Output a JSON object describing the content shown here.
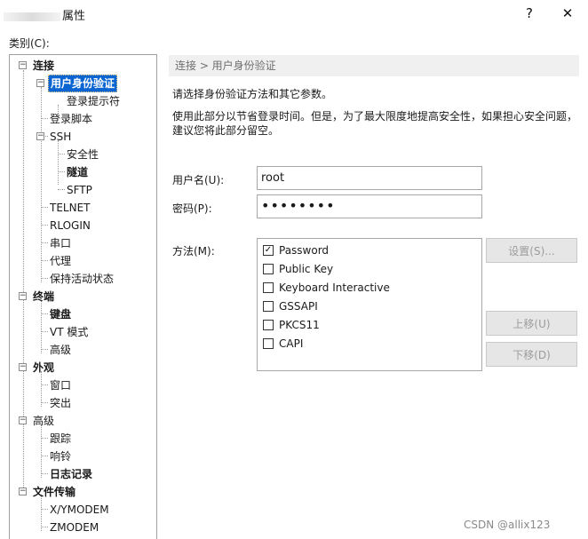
{
  "window": {
    "title": "属性",
    "help_label": "?",
    "close_label": "✕"
  },
  "category_label": "类别(C):",
  "tree": [
    {
      "label": "连接",
      "bold": true,
      "expander": "−"
    },
    {
      "label": "用户身份验证",
      "bold": true,
      "selected": true,
      "expander": "−"
    },
    {
      "label": "登录提示符"
    },
    {
      "label": "登录脚本"
    },
    {
      "label": "SSH",
      "expander": "−"
    },
    {
      "label": "安全性"
    },
    {
      "label": "隧道",
      "bold": true
    },
    {
      "label": "SFTP"
    },
    {
      "label": "TELNET"
    },
    {
      "label": "RLOGIN"
    },
    {
      "label": "串口"
    },
    {
      "label": "代理"
    },
    {
      "label": "保持活动状态"
    },
    {
      "label": "终端",
      "bold": true,
      "expander": "−"
    },
    {
      "label": "键盘",
      "bold": true
    },
    {
      "label": "VT 模式"
    },
    {
      "label": "高级"
    },
    {
      "label": "外观",
      "bold": true,
      "expander": "−"
    },
    {
      "label": "窗口"
    },
    {
      "label": "突出"
    },
    {
      "label": "高级",
      "expander": "−"
    },
    {
      "label": "跟踪"
    },
    {
      "label": "响铃"
    },
    {
      "label": "日志记录",
      "bold": true
    },
    {
      "label": "文件传输",
      "bold": true,
      "expander": "−"
    },
    {
      "label": "X/YMODEM"
    },
    {
      "label": "ZMODEM"
    }
  ],
  "breadcrumb": "连接 > 用户身份验证",
  "description": {
    "line1": "请选择身份验证方法和其它参数。",
    "line2": "使用此部分以节省登录时间。但是，为了最大限度地提高安全性，如果担心安全问题，",
    "line3": "建议您将此部分留空。"
  },
  "form": {
    "username_label": "用户名(U):",
    "username_value": "root",
    "password_label": "密码(P):",
    "password_value": "••••••••",
    "method_label": "方法(M):"
  },
  "methods": [
    {
      "label": "Password",
      "checked": true
    },
    {
      "label": "Public Key",
      "checked": false
    },
    {
      "label": "Keyboard Interactive",
      "checked": false
    },
    {
      "label": "GSSAPI",
      "checked": false
    },
    {
      "label": "PKCS11",
      "checked": false
    },
    {
      "label": "CAPI",
      "checked": false
    }
  ],
  "buttons": {
    "settings": "设置(S)...",
    "move_up": "上移(U)",
    "move_down": "下移(D)"
  },
  "watermark": "CSDN @allix123"
}
